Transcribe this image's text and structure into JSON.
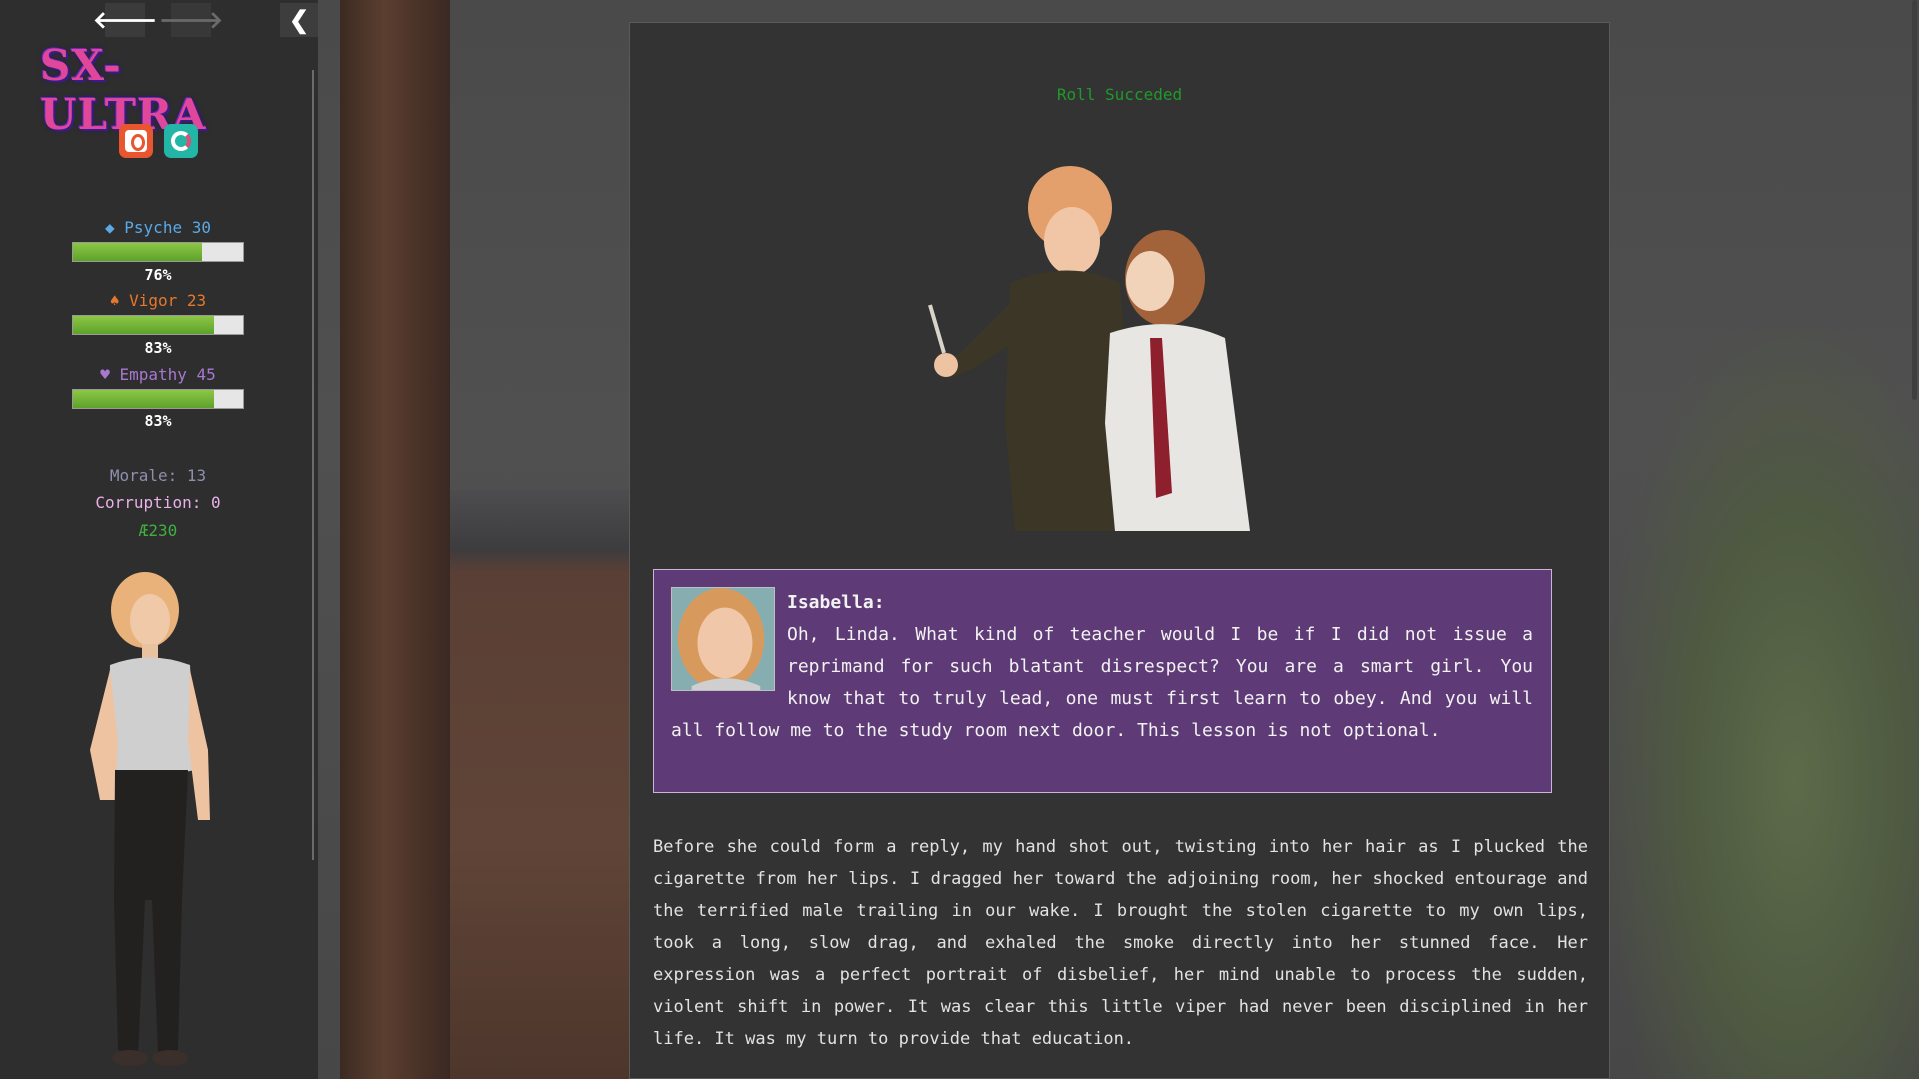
{
  "nav": {
    "back_icon": "arrow-left-icon",
    "forward_icon": "arrow-right-icon",
    "collapse_icon": "chevron-left-icon",
    "back_glyph": "🡐",
    "forward_glyph": "🡒",
    "collapse_glyph": "❮"
  },
  "brand": {
    "logo_text": "SX-ULTRA",
    "patreon_icon": "patreon-icon",
    "subscribestar_icon": "subscribestar-icon"
  },
  "stats": [
    {
      "glyph": "◆",
      "name": "Psyche",
      "value": "30",
      "percent": 76,
      "percent_label": "76%",
      "color": "#5aa9e6"
    },
    {
      "glyph": "♠",
      "name": "Vigor",
      "value": "23",
      "percent": 83,
      "percent_label": "83%",
      "color": "#e6782c"
    },
    {
      "glyph": "♥",
      "name": "Empathy",
      "value": "45",
      "percent": 83,
      "percent_label": "83%",
      "color": "#a877d0"
    }
  ],
  "resources": {
    "morale": "Morale: 13",
    "corruption": "Corruption: 0",
    "currency": "Æ230",
    "colors": {
      "morale": "#8f8fae",
      "corruption": "#e9b0e9",
      "currency": "#3fb040"
    }
  },
  "story": {
    "roll_result": "Roll Succeded",
    "speaker": "Isabella:",
    "dialogue": "Oh, Linda. What kind of teacher would I be if I did not issue a reprimand for such blatant disrespect? You are a smart girl. You know that to truly lead, one must first learn to obey. And you will all follow me to the study room next door. This lesson is not optional.",
    "narration": "Before she could form a reply, my hand shot out, twisting into her hair as I plucked the cigarette from her lips. I dragged her toward the adjoining room, her shocked entourage and the terrified male trailing in our wake. I brought the stolen cigarette to my own lips, took a long, slow drag, and exhaled the smoke directly into her stunned face. Her expression was a perfect portrait of disbelief, her mind unable to process the sudden, violent shift in power. It was clear this little viper had never been disciplined in her life. It was my turn to provide that education."
  }
}
